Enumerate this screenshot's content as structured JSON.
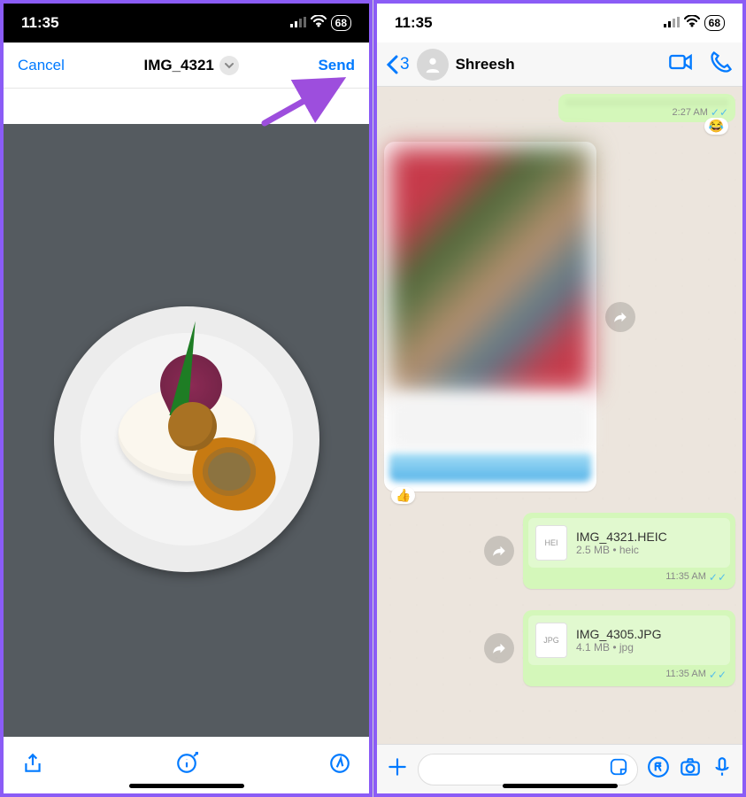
{
  "status": {
    "time": "11:35",
    "battery": "68"
  },
  "left": {
    "cancel": "Cancel",
    "fileTitle": "IMG_4321",
    "send": "Send"
  },
  "right": {
    "backCount": "3",
    "contact": "Shreesh",
    "msgStub": {
      "time": "2:27 AM"
    },
    "file1": {
      "name": "IMG_4321.HEIC",
      "meta": "2.5 MB • heic",
      "label": "HEI",
      "time": "11:35 AM"
    },
    "file2": {
      "name": "IMG_4305.JPG",
      "meta": "4.1 MB • jpg",
      "label": "JPG",
      "time": "11:35 AM"
    }
  }
}
